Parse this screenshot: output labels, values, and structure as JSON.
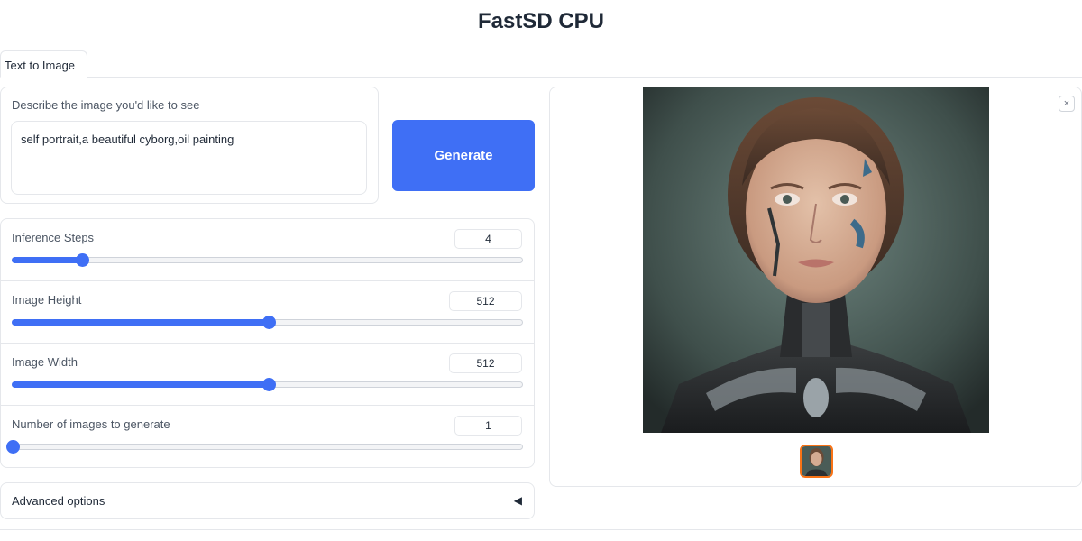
{
  "app": {
    "title": "FastSD CPU"
  },
  "tabs": [
    {
      "label": "Text to Image"
    }
  ],
  "prompt": {
    "label": "Describe the image you'd like to see",
    "value": "self portrait,a beautiful cyborg,oil painting"
  },
  "generate": {
    "label": "Generate"
  },
  "sliders": [
    {
      "label": "Inference Steps",
      "value": "4",
      "fraction": 0.135
    },
    {
      "label": "Image Height",
      "value": "512",
      "fraction": 0.5
    },
    {
      "label": "Image Width",
      "value": "512",
      "fraction": 0.5
    },
    {
      "label": "Number of images to generate",
      "value": "1",
      "fraction": 0.0
    }
  ],
  "advanced": {
    "label": "Advanced options",
    "arrow": "◀"
  },
  "gallery": {
    "close_icon": "×"
  },
  "colors": {
    "accent": "#3f6ff5",
    "selected_border": "#f97316"
  }
}
